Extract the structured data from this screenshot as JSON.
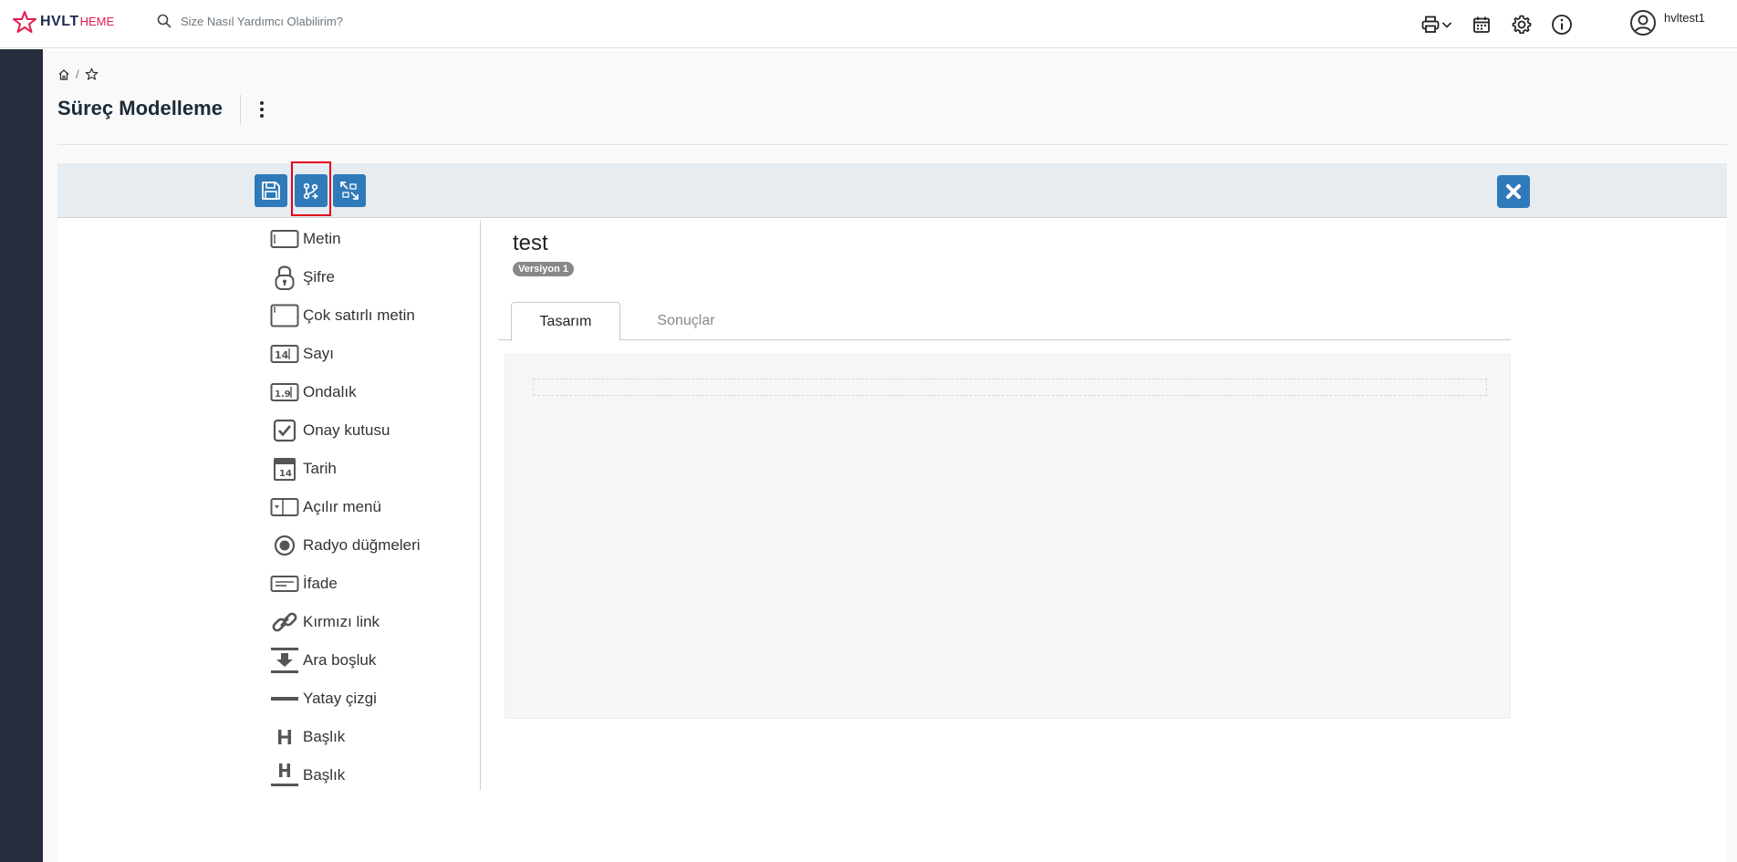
{
  "header": {
    "logo_main": "HVLT",
    "logo_sub": "HEME",
    "logo_colors": {
      "main": "#1c2b4a",
      "accent": "#e21b4d"
    },
    "search_placeholder": "Size Nasıl Yardımcı Olabilirim?",
    "icons": [
      "printer-icon",
      "chevron-down-icon",
      "calendar-icon",
      "gear-icon",
      "info-icon"
    ],
    "user": {
      "name": "hvltest1",
      "icon": "user-circle-icon"
    }
  },
  "breadcrumb": {
    "home_icon": "home-icon",
    "separator": "/",
    "favorite_icon": "star-icon"
  },
  "page": {
    "title": "Süreç Modelleme",
    "menu_icon": "kebab-icon"
  },
  "toolbar": {
    "buttons": [
      {
        "name": "save-button",
        "icon": "floppy-icon"
      },
      {
        "name": "add-flow-button",
        "icon": "flow-add-icon",
        "highlighted": true
      },
      {
        "name": "expand-button",
        "icon": "expand-icon"
      }
    ],
    "close_icon": "close-icon",
    "accent": "#2f7ab8",
    "highlight_color": "#e3001b"
  },
  "palette": {
    "items": [
      {
        "label": "Metin",
        "icon": "textbox-icon"
      },
      {
        "label": "Şifre",
        "icon": "lock-icon"
      },
      {
        "label": "Çok satırlı metin",
        "icon": "textarea-icon"
      },
      {
        "label": "Sayı",
        "icon": "number-icon"
      },
      {
        "label": "Ondalık",
        "icon": "decimal-icon"
      },
      {
        "label": "Onay kutusu",
        "icon": "checkbox-icon"
      },
      {
        "label": "Tarih",
        "icon": "calendar-day-icon"
      },
      {
        "label": "Açılır menü",
        "icon": "dropdown-icon"
      },
      {
        "label": "Radyo düğmeleri",
        "icon": "radio-icon"
      },
      {
        "label": "İfade",
        "icon": "expression-icon"
      },
      {
        "label": "Kırmızı link",
        "icon": "link-icon"
      },
      {
        "label": "Ara boşluk",
        "icon": "spacer-icon"
      },
      {
        "label": "Yatay çizgi",
        "icon": "hr-icon"
      },
      {
        "label": "Başlık",
        "icon": "heading-icon"
      },
      {
        "label": "Başlık",
        "icon": "heading-underlined-icon"
      }
    ]
  },
  "form": {
    "name": "test",
    "version": "Versiyon 1",
    "tabs": [
      {
        "label": "Tasarım",
        "active": true
      },
      {
        "label": "Sonuçlar",
        "active": false
      }
    ]
  }
}
